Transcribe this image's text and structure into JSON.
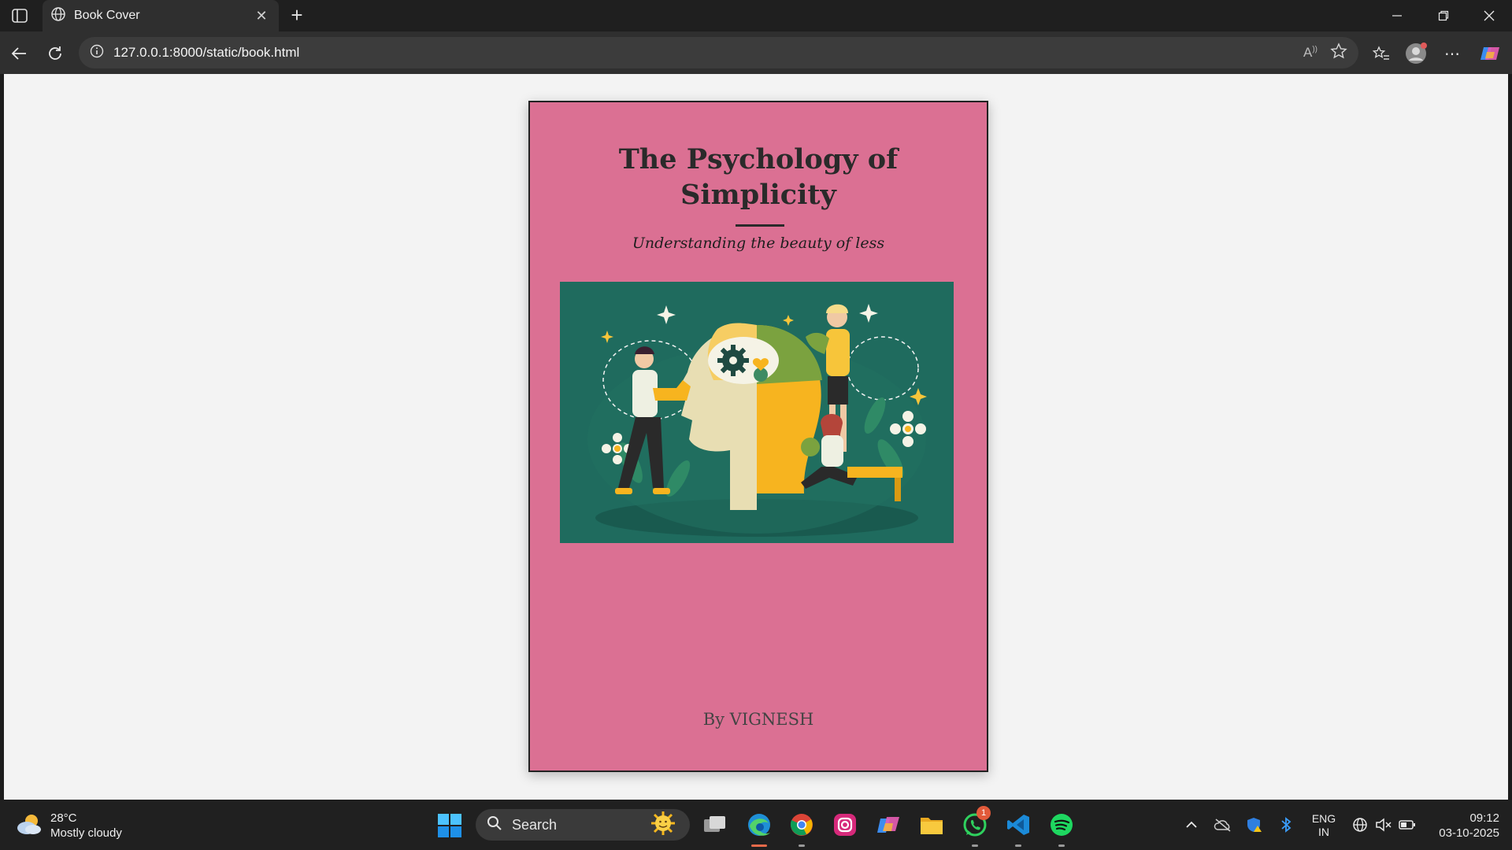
{
  "browser": {
    "tab_title": "Book Cover",
    "url": "127.0.0.1:8000/static/book.html"
  },
  "book": {
    "title": "The Psychology of Simplicity",
    "subtitle": "Understanding the beauty of less",
    "author": "By VIGNESH",
    "cover_color": "#db7093",
    "art_background": "#1f6b5e"
  },
  "taskbar": {
    "weather_temp": "28°C",
    "weather_desc": "Mostly cloudy",
    "search_label": "Search",
    "whatsapp_badge": "1",
    "lang_line1": "ENG",
    "lang_line2": "IN",
    "time": "09:12",
    "date": "03-10-2025"
  }
}
